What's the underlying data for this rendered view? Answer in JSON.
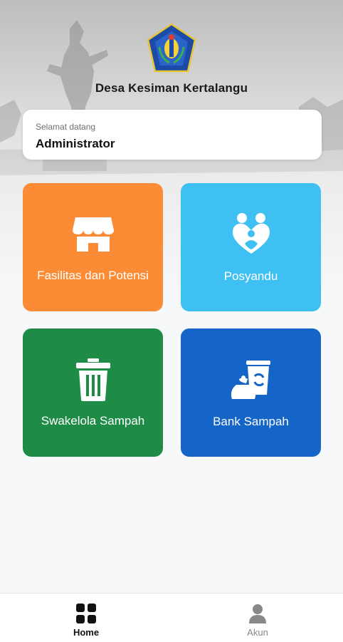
{
  "header": {
    "title": "Desa Kesiman Kertalangu",
    "logo_icon": "village-emblem-icon"
  },
  "welcome": {
    "greeting": "Selamat datang",
    "user": "Administrator"
  },
  "menu": [
    {
      "label": "Fasilitas dan Potensi",
      "icon": "store-icon",
      "color": "#fb8c35"
    },
    {
      "label": "Posyandu",
      "icon": "family-care-icon",
      "color": "#3fc0f2"
    },
    {
      "label": "Swakelola Sampah",
      "icon": "trash-bin-icon",
      "color": "#1e8c46"
    },
    {
      "label": "Bank Sampah",
      "icon": "recycle-bin-icon",
      "color": "#1565c8"
    }
  ],
  "bottom_nav": {
    "active": "Home",
    "items": [
      {
        "label": "Home",
        "icon": "grid-icon"
      },
      {
        "label": "Akun",
        "icon": "person-icon"
      }
    ]
  }
}
